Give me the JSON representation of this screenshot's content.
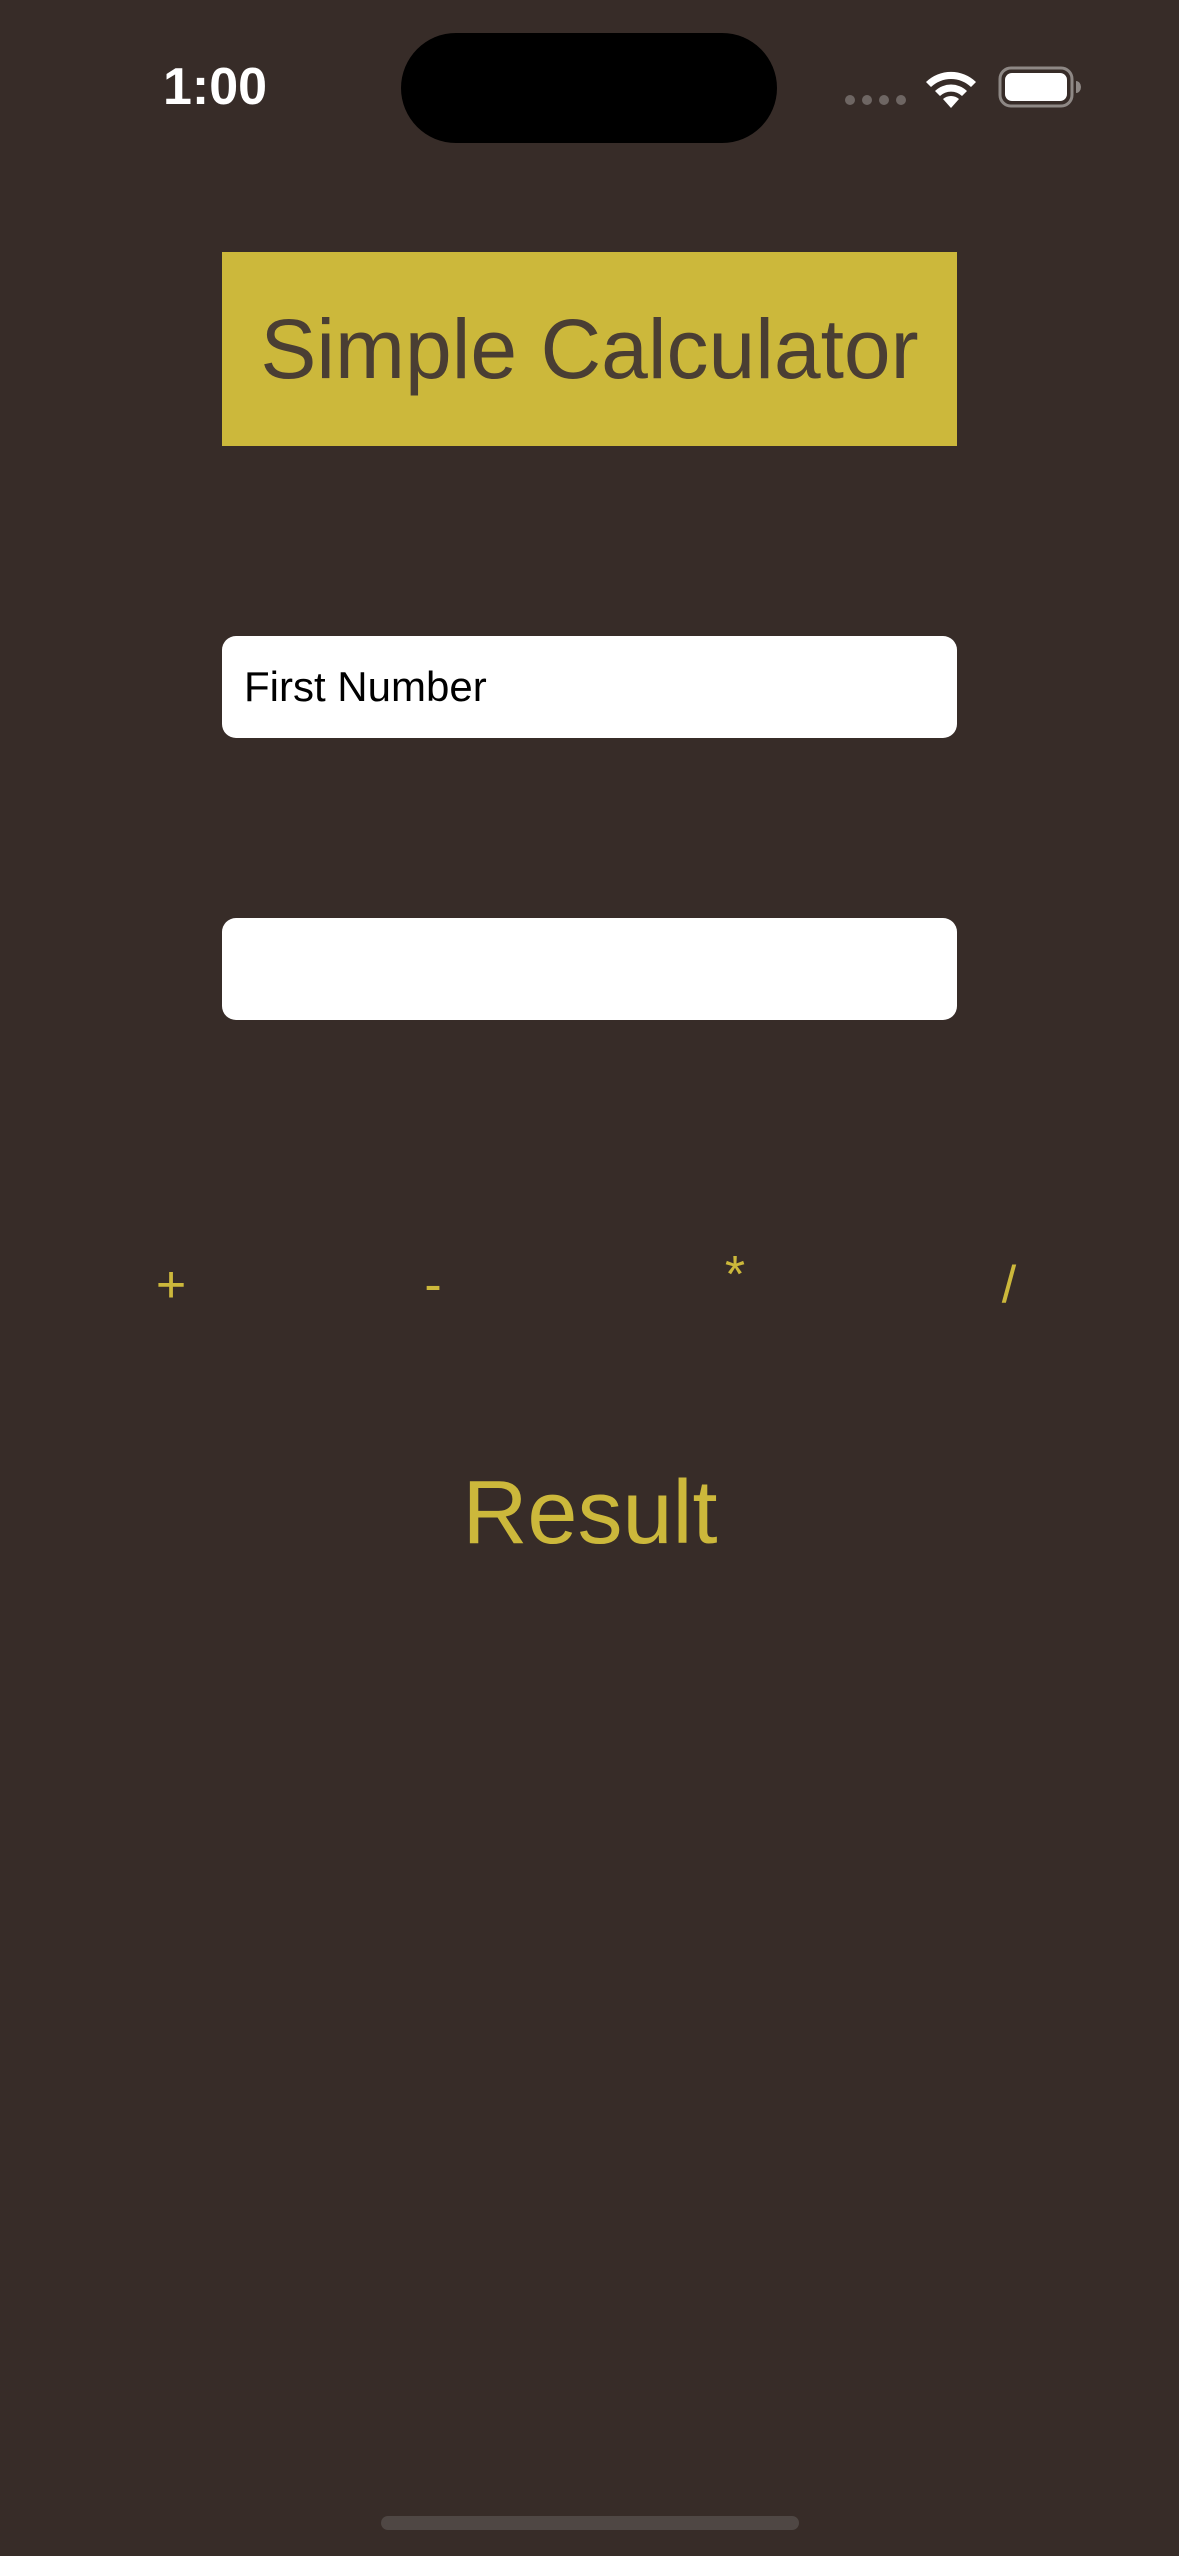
{
  "status_bar": {
    "time": "1:00",
    "icons": [
      "signal-dots-icon",
      "wifi-icon",
      "battery-icon"
    ]
  },
  "title": "Simple Calculator",
  "inputs": {
    "first_placeholder": "First Number",
    "first_value": "",
    "second_placeholder": "",
    "second_value": ""
  },
  "operators": {
    "add": "+",
    "subtract": "-",
    "multiply": "*",
    "divide": "/"
  },
  "result_label": "Result",
  "colors": {
    "background": "#372c28",
    "accent": "#ccb83b",
    "title_text": "#4a3e33",
    "field_background": "#ffffff"
  }
}
